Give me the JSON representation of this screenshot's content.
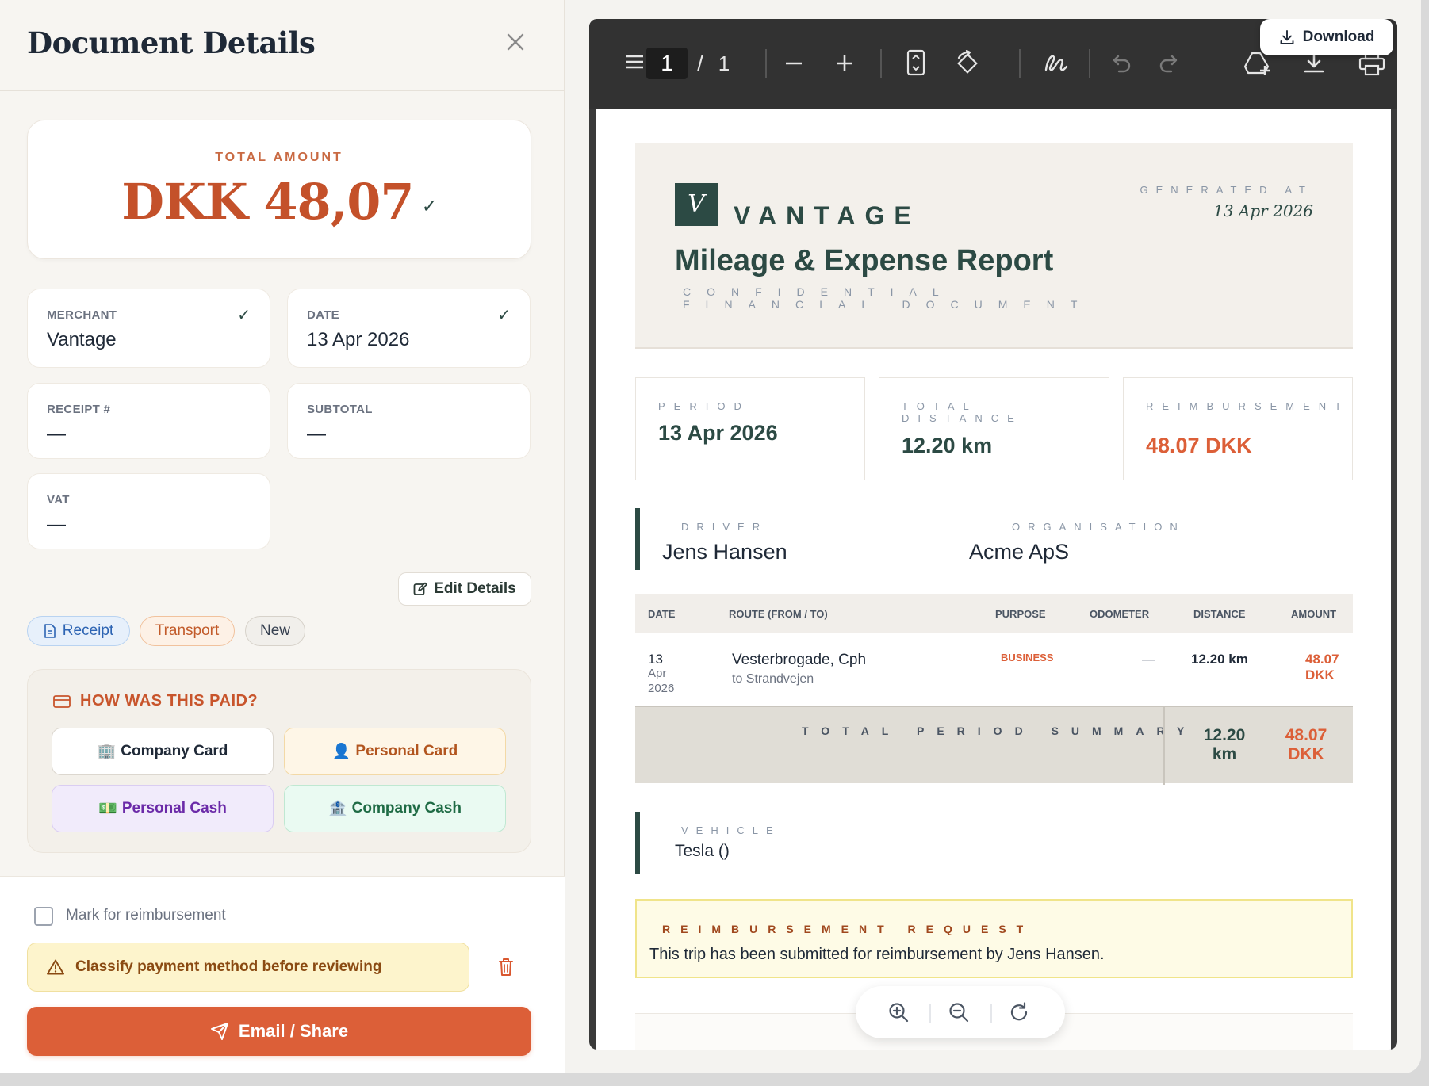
{
  "panel": {
    "title": "Document Details",
    "total_label": "TOTAL AMOUNT",
    "total_value": "DKK 48,07",
    "total_check": "✓",
    "fields": {
      "merchant": {
        "label": "MERCHANT",
        "value": "Vantage",
        "check": "✓"
      },
      "date": {
        "label": "DATE",
        "value": "13 Apr 2026",
        "check": "✓"
      },
      "receipt": {
        "label": "RECEIPT #",
        "value": "—"
      },
      "subtotal": {
        "label": "SUBTOTAL",
        "value": "—"
      },
      "vat": {
        "label": "VAT",
        "value": "—"
      }
    },
    "edit_label": "Edit Details",
    "tags": {
      "receipt": "Receipt",
      "transport": "Transport",
      "new": "New"
    },
    "paid": {
      "title": "HOW WAS THIS PAID?",
      "options": {
        "company_card": {
          "emoji": "🏢",
          "label": "Company Card"
        },
        "personal_card": {
          "emoji": "👤",
          "label": "Personal Card"
        },
        "personal_cash": {
          "emoji": "💵",
          "label": "Personal Cash"
        },
        "company_cash": {
          "emoji": "🏦",
          "label": "Company Cash"
        }
      }
    },
    "reimburse_label": "Mark for reimbursement",
    "warning": "Classify payment method before reviewing",
    "email_label": "Email / Share"
  },
  "viewer": {
    "page_current": "1",
    "page_sep": "/",
    "page_total": "1",
    "download_label": "Download"
  },
  "report": {
    "logo_letter": "V",
    "brand": "VANTAGE",
    "generated_label": "GENERATED AT",
    "generated_date": "13 Apr 2026",
    "title": "Mileage & Expense Report",
    "subtitle": "CONFIDENTIAL FINANCIAL DOCUMENT",
    "stats": {
      "period": {
        "label": "PERIOD",
        "value": "13 Apr 2026"
      },
      "distance": {
        "label": "TOTAL DISTANCE",
        "value": "12.20 km"
      },
      "reimbursement": {
        "label": "REIMBURSEMENT",
        "value": "48.07 DKK"
      }
    },
    "driver": {
      "label": "DRIVER",
      "value": "Jens Hansen"
    },
    "organisation": {
      "label": "ORGANISATION",
      "value": "Acme ApS"
    },
    "table": {
      "headers": [
        "DATE",
        "ROUTE (FROM / TO)",
        "PURPOSE",
        "ODOMETER",
        "DISTANCE",
        "AMOUNT"
      ],
      "row": {
        "date_day": "13",
        "date_month": "Apr",
        "date_year": "2026",
        "from": "Vesterbrogade, Cph",
        "to": "to Strandvejen",
        "purpose": "BUSINESS",
        "odometer": "—",
        "distance": "12.20 km",
        "amount_value": "48.07",
        "amount_currency": "DKK"
      },
      "summary_label": "TOTAL PERIOD SUMMARY",
      "summary_distance_value": "12.20",
      "summary_distance_unit": "km",
      "summary_amount_value": "48.07",
      "summary_amount_currency": "DKK"
    },
    "vehicle": {
      "label": "VEHICLE",
      "value": "Tesla  ()"
    },
    "request": {
      "label": "REIMBURSEMENT REQUEST",
      "text": "This trip has been submitted for reimbursement by Jens Hansen."
    }
  },
  "colors": {
    "accent": "#dc5f38",
    "brand_green": "#2c4a44",
    "warning_bg": "#fdf4cc"
  }
}
